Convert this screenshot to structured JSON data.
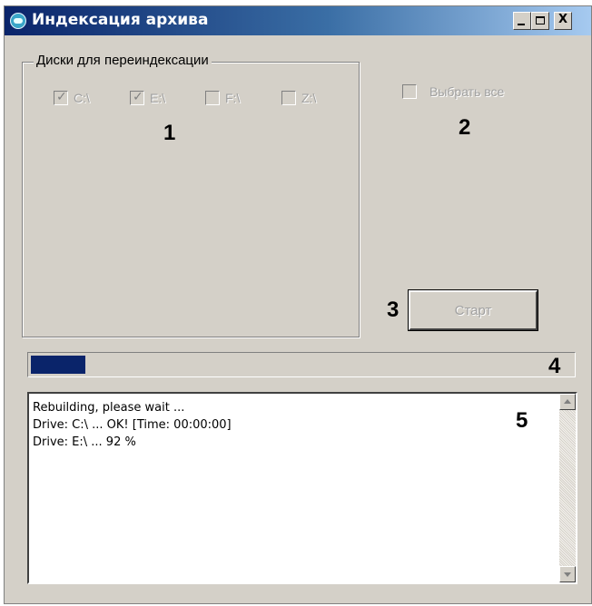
{
  "window": {
    "title": "Индексация архива",
    "controls": {
      "minimize": "_",
      "maximize": "□",
      "close": "X"
    }
  },
  "drives_group": {
    "legend": "Диски для переиндексации",
    "drives": [
      {
        "label": "C:\\",
        "checked": true,
        "enabled": false
      },
      {
        "label": "E:\\",
        "checked": true,
        "enabled": false
      },
      {
        "label": "F:\\",
        "checked": false,
        "enabled": false
      },
      {
        "label": "Z:\\",
        "checked": false,
        "enabled": false
      }
    ]
  },
  "select_all": {
    "label": "Выбрать все",
    "checked": false,
    "enabled": false
  },
  "start_button": {
    "label": "Старт",
    "enabled": false
  },
  "progress": {
    "value_fraction": 0.1
  },
  "log": {
    "lines": [
      "Rebuilding, please wait ...",
      "Drive: C:\\ ... OK! [Time: 00:00:00]",
      "Drive: E:\\ ... 92 %"
    ]
  },
  "callouts": [
    "1",
    "2",
    "3",
    "4",
    "5"
  ],
  "colors": {
    "titlebar_start": "#0a246a",
    "titlebar_end": "#a6caf0",
    "progress_fill": "#0a246a",
    "window_bg": "#d4d0c8"
  }
}
